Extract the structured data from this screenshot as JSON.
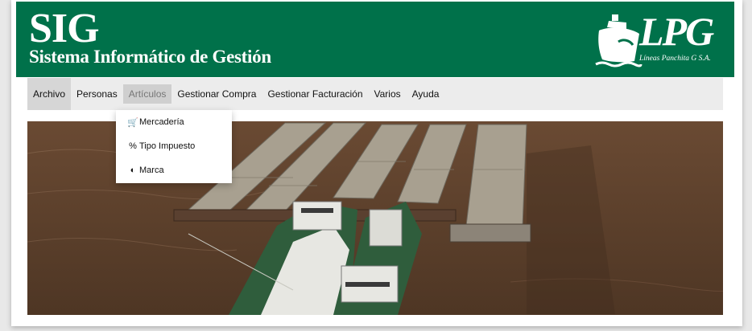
{
  "header": {
    "title": "SIG",
    "subtitle": "Sistema Informático de Gestión",
    "logo_text": "LPG",
    "logo_subtext": "Líneas Panchita G S.A."
  },
  "nav": {
    "items": [
      {
        "label": "Archivo"
      },
      {
        "label": "Personas"
      },
      {
        "label": "Artículos"
      },
      {
        "label": "Gestionar Compra"
      },
      {
        "label": "Gestionar Facturación"
      },
      {
        "label": "Varios"
      },
      {
        "label": "Ayuda"
      }
    ]
  },
  "dropdown": {
    "items": [
      {
        "label": "Mercadería",
        "icon": "dolly-icon"
      },
      {
        "label": "Tipo Impuesto",
        "icon": "percent-icon"
      },
      {
        "label": "Marca",
        "icon": "shield-icon"
      }
    ]
  },
  "colors": {
    "header_bg": "#00714a",
    "nav_bg": "#ececec",
    "water": "#5b3f2b"
  }
}
